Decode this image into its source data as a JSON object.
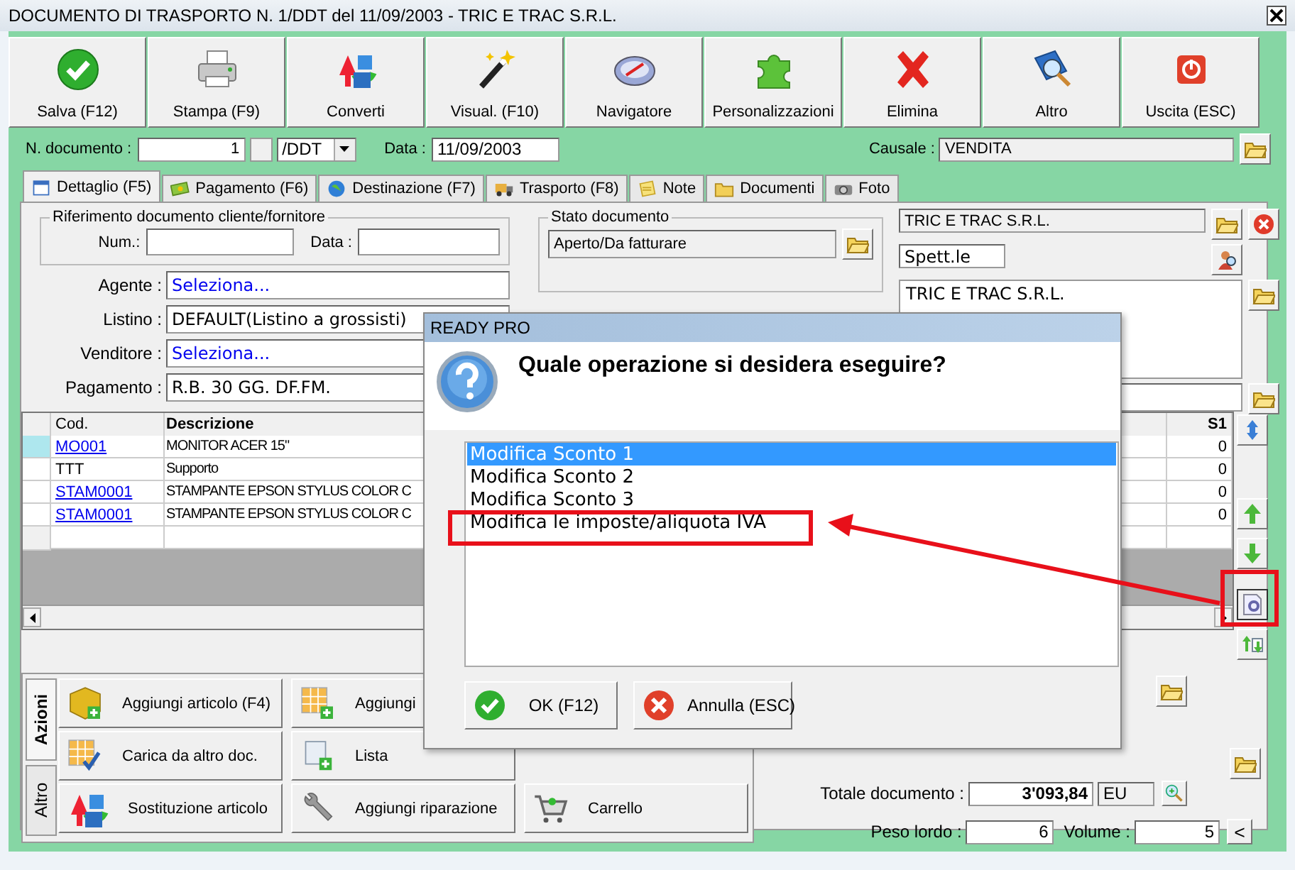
{
  "window": {
    "title": "DOCUMENTO DI TRASPORTO N. 1/DDT del 11/09/2003 - TRIC E TRAC S.R.L."
  },
  "toolbar": [
    {
      "label": "Salva (F12)",
      "kind": "save"
    },
    {
      "label": "Stampa (F9)",
      "kind": "print"
    },
    {
      "label": "Converti",
      "kind": "convert"
    },
    {
      "label": "Visual. (F10)",
      "kind": "view"
    },
    {
      "label": "Navigatore",
      "kind": "navigator"
    },
    {
      "label": "Personalizzazioni",
      "kind": "custom"
    },
    {
      "label": "Elimina",
      "kind": "delete"
    },
    {
      "label": "Altro",
      "kind": "other"
    },
    {
      "label": "Uscita (ESC)",
      "kind": "exit"
    }
  ],
  "document": {
    "number_label": "N. documento :",
    "number": "1",
    "series": "/DDT",
    "date_label": "Data :",
    "date": "11/09/2003",
    "reason_label": "Causale :",
    "reason": "VENDITA"
  },
  "tabs": [
    {
      "label": "Dettaglio (F5)",
      "kind": "detail",
      "selected": true
    },
    {
      "label": "Pagamento (F6)",
      "kind": "payment",
      "selected": false
    },
    {
      "label": "Destinazione (F7)",
      "kind": "destination",
      "selected": false
    },
    {
      "label": "Trasporto (F8)",
      "kind": "transport",
      "selected": false
    },
    {
      "label": "Note",
      "kind": "notes",
      "selected": false
    },
    {
      "label": "Documenti",
      "kind": "documents",
      "selected": false
    },
    {
      "label": "Foto",
      "kind": "photo",
      "selected": false
    }
  ],
  "reference": {
    "title": "Riferimento documento cliente/fornitore",
    "number_label": "Num.:",
    "date_label": "Data :"
  },
  "fields": [
    {
      "label": "Agente :",
      "value": "Seleziona...",
      "kind": "link"
    },
    {
      "label": "Listino :",
      "value": "DEFAULT(Listino a grossisti)",
      "kind": "text"
    },
    {
      "label": "Venditore :",
      "value": "Seleziona...",
      "kind": "link"
    },
    {
      "label": "Pagamento :",
      "value": "R.B. 30 GG. DF.FM.",
      "kind": "text"
    }
  ],
  "status": {
    "title": "Stato documento",
    "value": "Aperto/Da fatturare"
  },
  "customer": {
    "name": "TRIC E TRAC S.R.L.",
    "salutation": "Spett.le",
    "address": "TRIC E TRAC S.R.L."
  },
  "table": {
    "columns": [
      "Cod.",
      "Descrizione"
    ],
    "last_column": "S1",
    "rows": [
      {
        "code": "MO001",
        "linked": true,
        "description": "MONITOR ACER 15\"",
        "s1": "0",
        "selected": true
      },
      {
        "code": "TTT",
        "linked": false,
        "description": "Supporto",
        "s1": "0",
        "selected": false
      },
      {
        "code": "STAM0001",
        "linked": true,
        "description": "STAMPANTE EPSON STYLUS COLOR C",
        "s1": "0",
        "selected": false
      },
      {
        "code": "STAM0001",
        "linked": true,
        "description": "STAMPANTE EPSON STYLUS COLOR C",
        "s1": "0",
        "selected": false
      }
    ]
  },
  "action_tabs": [
    {
      "label": "Azioni",
      "selected": true
    },
    {
      "label": "Altro",
      "selected": false
    }
  ],
  "actions": [
    {
      "label": "Aggiungi articolo (F4)",
      "kind": "box"
    },
    {
      "label": "Aggiungi",
      "kind": "grid"
    },
    {
      "kind": "hidden"
    },
    {
      "label": "Carica da altro doc.",
      "kind": "grid_check"
    },
    {
      "label": "Lista",
      "kind": "scroll"
    },
    {
      "kind": "hidden"
    },
    {
      "label": "Sostituzione articolo",
      "kind": "convert"
    },
    {
      "label": "Aggiungi riparazione",
      "kind": "wrench"
    },
    {
      "label": "Carrello",
      "kind": "cart"
    }
  ],
  "totals": {
    "total_label": "Totale documento :",
    "total": "3'093,84",
    "currency": "EU",
    "weight_label": "Peso lordo :",
    "weight": "6",
    "volume_label": "Volume :",
    "volume": "5",
    "collapse": "<"
  },
  "dialog": {
    "title": "READY PRO",
    "question": "Quale operazione si desidera eseguire?",
    "options": [
      {
        "label": "Modifica Sconto 1",
        "selected": true
      },
      {
        "label": "Modifica Sconto 2",
        "selected": false
      },
      {
        "label": "Modifica Sconto 3",
        "selected": false
      },
      {
        "label": "Modifica le imposte/aliquota IVA",
        "selected": false
      }
    ],
    "buttons": [
      {
        "label": "OK (F12)",
        "kind": "ok"
      },
      {
        "label": "Annulla (ESC)",
        "kind": "cancel"
      }
    ]
  }
}
